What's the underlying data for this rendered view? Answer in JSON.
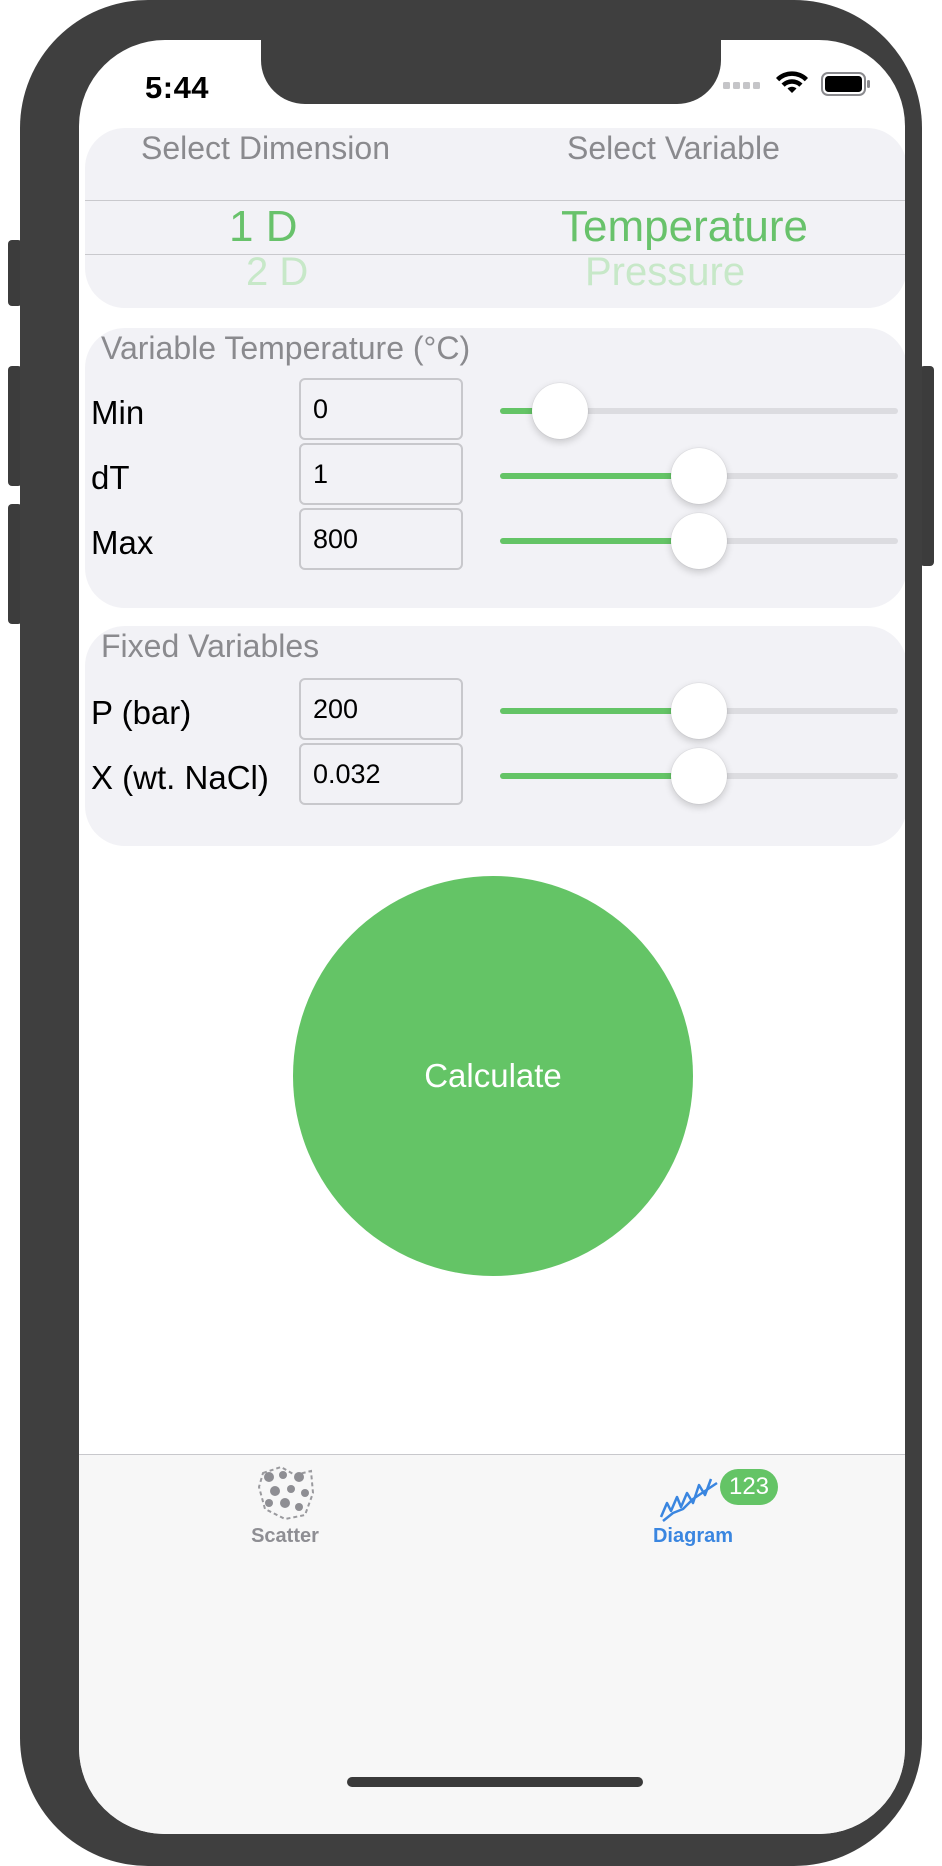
{
  "status_bar": {
    "time": "5:44"
  },
  "picker": {
    "dimension_header": "Select Dimension",
    "variable_header": "Select Variable",
    "dimension_selected": "1 D",
    "dimension_next": "2 D",
    "variable_selected": "Temperature",
    "variable_next": "Pressure"
  },
  "variable_panel": {
    "title": "Variable Temperature (°C)",
    "rows": [
      {
        "label": "Min",
        "value": "0",
        "slider_fraction": 0.15
      },
      {
        "label": "dT",
        "value": "1",
        "slider_fraction": 0.5
      },
      {
        "label": "Max",
        "value": "800",
        "slider_fraction": 0.5
      }
    ]
  },
  "fixed_panel": {
    "title": "Fixed Variables",
    "rows": [
      {
        "label": "P (bar)",
        "value": "200",
        "slider_fraction": 0.5
      },
      {
        "label": "X (wt. NaCl)",
        "value": "0.032",
        "slider_fraction": 0.5
      }
    ]
  },
  "calculate_button": {
    "label": "Calculate"
  },
  "tab_bar": {
    "tabs": [
      {
        "label": "Scatter",
        "icon": "scatter-icon",
        "selected": false
      },
      {
        "label": "Diagram",
        "icon": "diagram-icon",
        "selected": true,
        "badge": "123"
      }
    ]
  },
  "colors": {
    "accent_green": "#64c466",
    "tab_selected_blue": "#3a86e0",
    "tab_unselected_gray": "#8e8e93",
    "device_frame": "#3f3f3f"
  }
}
